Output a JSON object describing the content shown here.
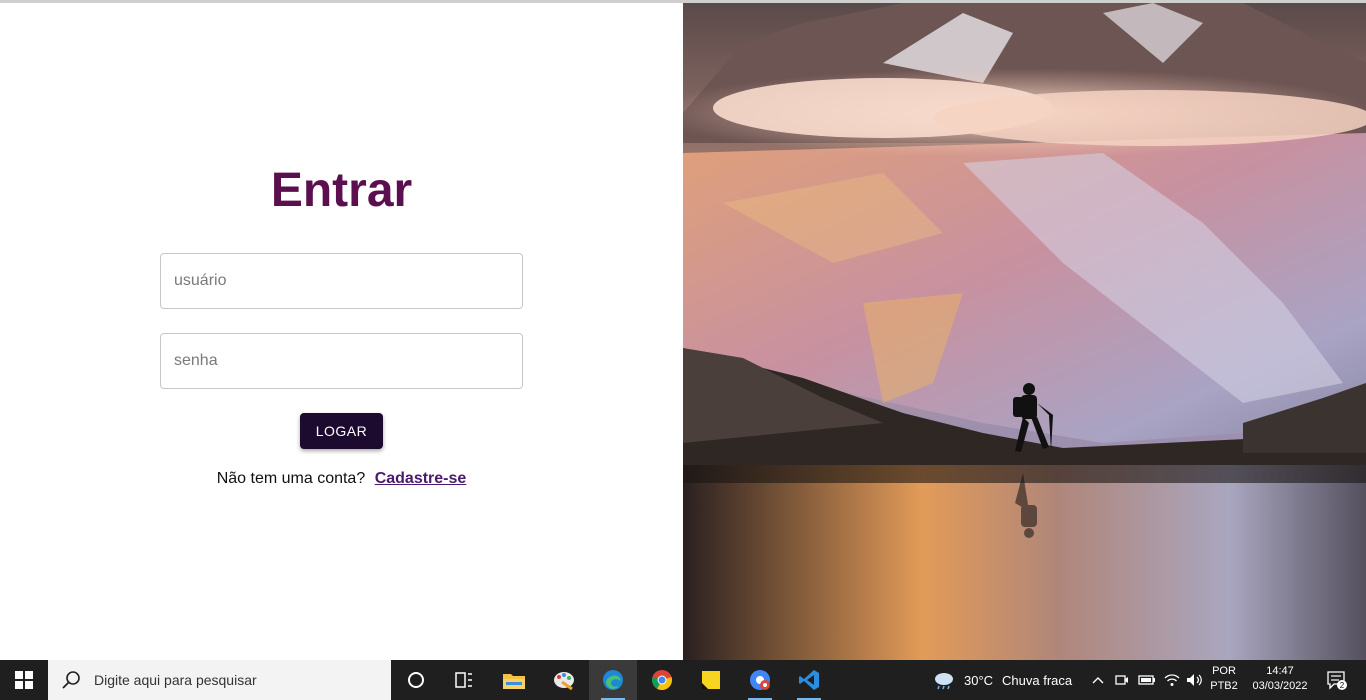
{
  "login": {
    "title": "Entrar",
    "username_placeholder": "usuário",
    "password_placeholder": "senha",
    "submit_label": "LOGAR",
    "signup_prompt": "Não tem uma conta?",
    "signup_link": "Cadastre-se"
  },
  "colors": {
    "title": "#5c0f4f",
    "button_bg": "#1d0a2f",
    "link": "#4a1a6e",
    "taskbar": "#1f1f1f"
  },
  "taskbar": {
    "search_placeholder": "Digite aqui para pesquisar",
    "apps": [
      {
        "icon": "cortana-icon"
      },
      {
        "icon": "task-view-icon"
      },
      {
        "icon": "file-explorer-icon"
      },
      {
        "icon": "paint-icon"
      },
      {
        "icon": "edge-icon"
      },
      {
        "icon": "chrome-icon"
      },
      {
        "icon": "sticky-notes-icon"
      },
      {
        "icon": "chrome-app-icon"
      },
      {
        "icon": "vscode-icon"
      }
    ],
    "weather": {
      "temperature": "30°C",
      "condition": "Chuva fraca"
    },
    "language": {
      "line1": "POR",
      "line2": "PTB2"
    },
    "time": "14:47",
    "date": "03/03/2022",
    "notification_count": "2"
  }
}
